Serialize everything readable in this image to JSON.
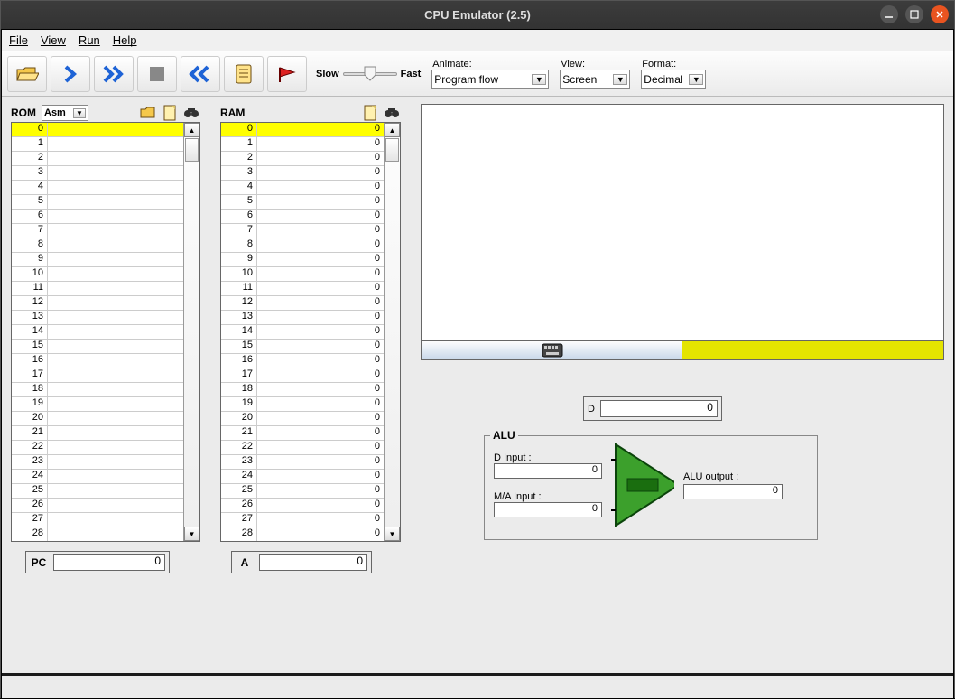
{
  "window": {
    "title": "CPU Emulator (2.5)"
  },
  "menubar": {
    "file": "File",
    "view": "View",
    "run": "Run",
    "help": "Help"
  },
  "toolbar": {
    "slow": "Slow",
    "fast": "Fast",
    "animate_label": "Animate:",
    "animate_value": "Program flow",
    "view_label": "View:",
    "view_value": "Screen",
    "format_label": "Format:",
    "format_value": "Decimal"
  },
  "rom": {
    "label": "ROM",
    "mode": "Asm",
    "rows": [
      {
        "addr": "0",
        "val": ""
      },
      {
        "addr": "1",
        "val": ""
      },
      {
        "addr": "2",
        "val": ""
      },
      {
        "addr": "3",
        "val": ""
      },
      {
        "addr": "4",
        "val": ""
      },
      {
        "addr": "5",
        "val": ""
      },
      {
        "addr": "6",
        "val": ""
      },
      {
        "addr": "7",
        "val": ""
      },
      {
        "addr": "8",
        "val": ""
      },
      {
        "addr": "9",
        "val": ""
      },
      {
        "addr": "10",
        "val": ""
      },
      {
        "addr": "11",
        "val": ""
      },
      {
        "addr": "12",
        "val": ""
      },
      {
        "addr": "13",
        "val": ""
      },
      {
        "addr": "14",
        "val": ""
      },
      {
        "addr": "15",
        "val": ""
      },
      {
        "addr": "16",
        "val": ""
      },
      {
        "addr": "17",
        "val": ""
      },
      {
        "addr": "18",
        "val": ""
      },
      {
        "addr": "19",
        "val": ""
      },
      {
        "addr": "20",
        "val": ""
      },
      {
        "addr": "21",
        "val": ""
      },
      {
        "addr": "22",
        "val": ""
      },
      {
        "addr": "23",
        "val": ""
      },
      {
        "addr": "24",
        "val": ""
      },
      {
        "addr": "25",
        "val": ""
      },
      {
        "addr": "26",
        "val": ""
      },
      {
        "addr": "27",
        "val": ""
      },
      {
        "addr": "28",
        "val": ""
      }
    ],
    "highlight_index": 0
  },
  "ram": {
    "label": "RAM",
    "rows": [
      {
        "addr": "0",
        "val": "0"
      },
      {
        "addr": "1",
        "val": "0"
      },
      {
        "addr": "2",
        "val": "0"
      },
      {
        "addr": "3",
        "val": "0"
      },
      {
        "addr": "4",
        "val": "0"
      },
      {
        "addr": "5",
        "val": "0"
      },
      {
        "addr": "6",
        "val": "0"
      },
      {
        "addr": "7",
        "val": "0"
      },
      {
        "addr": "8",
        "val": "0"
      },
      {
        "addr": "9",
        "val": "0"
      },
      {
        "addr": "10",
        "val": "0"
      },
      {
        "addr": "11",
        "val": "0"
      },
      {
        "addr": "12",
        "val": "0"
      },
      {
        "addr": "13",
        "val": "0"
      },
      {
        "addr": "14",
        "val": "0"
      },
      {
        "addr": "15",
        "val": "0"
      },
      {
        "addr": "16",
        "val": "0"
      },
      {
        "addr": "17",
        "val": "0"
      },
      {
        "addr": "18",
        "val": "0"
      },
      {
        "addr": "19",
        "val": "0"
      },
      {
        "addr": "20",
        "val": "0"
      },
      {
        "addr": "21",
        "val": "0"
      },
      {
        "addr": "22",
        "val": "0"
      },
      {
        "addr": "23",
        "val": "0"
      },
      {
        "addr": "24",
        "val": "0"
      },
      {
        "addr": "25",
        "val": "0"
      },
      {
        "addr": "26",
        "val": "0"
      },
      {
        "addr": "27",
        "val": "0"
      },
      {
        "addr": "28",
        "val": "0"
      }
    ],
    "highlight_index": 0
  },
  "registers": {
    "pc_label": "PC",
    "pc_value": "0",
    "a_label": "A",
    "a_value": "0",
    "d_label": "D",
    "d_value": "0"
  },
  "alu": {
    "title": "ALU",
    "d_input_label": "D Input :",
    "d_input": "0",
    "ma_input_label": "M/A Input :",
    "ma_input": "0",
    "output_label": "ALU output :",
    "output": "0"
  },
  "keyboard": {
    "icon": "keyboard",
    "value": ""
  }
}
